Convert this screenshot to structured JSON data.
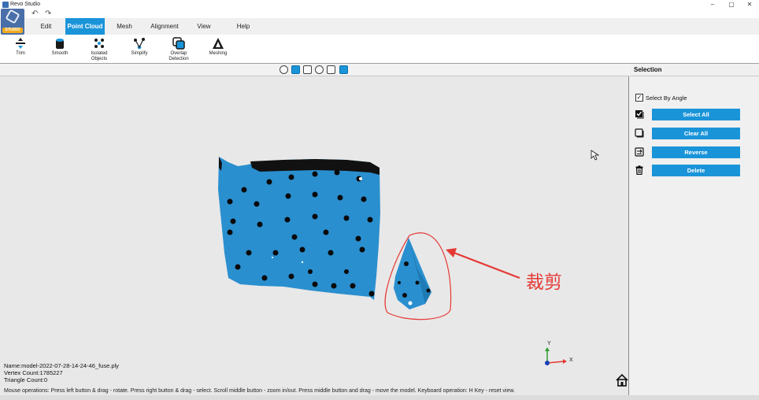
{
  "window": {
    "title": "Revo Studio",
    "minimize": "–",
    "maximize": "▢",
    "close": "✕"
  },
  "quick_access": {
    "undo": "↶",
    "redo": "↷"
  },
  "logo": {
    "badge": "STUDIO"
  },
  "menu": [
    {
      "label": "Edit"
    },
    {
      "label": "Point Cloud",
      "active": true
    },
    {
      "label": "Mesh"
    },
    {
      "label": "Alignment"
    },
    {
      "label": "View"
    },
    {
      "label": "Help"
    }
  ],
  "ribbon": [
    {
      "label": "Trim",
      "icon": "trim-icon"
    },
    {
      "label": "Smooth",
      "icon": "smooth-icon"
    },
    {
      "label": "Isolated\nObjects",
      "icon": "isolated-objects-icon"
    },
    {
      "label": "Simplify",
      "icon": "simplify-icon"
    },
    {
      "label": "Overlap\nDetection",
      "icon": "overlap-detection-icon"
    },
    {
      "label": "Meshing",
      "icon": "meshing-icon"
    }
  ],
  "viewport": {
    "annotation": "裁剪",
    "axis_y": "Y",
    "axis_x": "X",
    "info_name": "Name:model-2022-07-28-14-24-46_fuse.ply",
    "info_vertex": "Vertex Count:1785227",
    "info_triangle": "Triangle Count:0",
    "status": "Mouse operations: Press left button & drag - rotate. Press right button & drag - select. Scroll middle button - zoom in/out. Press  middle button and drag - move the model. Keyboard operation: H Key - reset view."
  },
  "panel": {
    "title": "Selection",
    "select_by_angle": "Select By Angle",
    "select_by_angle_checked": true,
    "buttons": [
      {
        "label": "Select All"
      },
      {
        "label": "Clear All"
      },
      {
        "label": "Reverse"
      },
      {
        "label": "Delete"
      }
    ]
  },
  "colors": {
    "accent": "#1a94d9",
    "model": "#2a8fcf",
    "annotation": "#e53935"
  }
}
